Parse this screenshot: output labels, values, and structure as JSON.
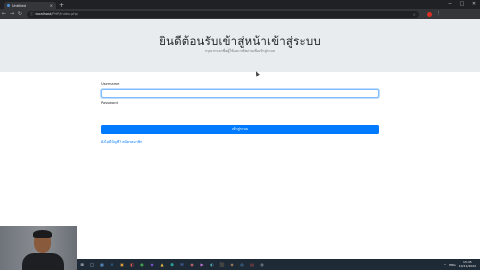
{
  "browser": {
    "tab_title": "Untitled",
    "tab_close": "×",
    "new_tab": "+",
    "window_controls": [
      "─",
      "□",
      "✕"
    ],
    "nav": [
      "←",
      "→",
      "↻"
    ],
    "url_host": "localhost",
    "url_path": "/PHP/index.php",
    "toolbar_icons": [
      "☆",
      "⋮"
    ]
  },
  "page": {
    "heading": "ยินดีต้อนรับเข้าสู่หน้าเข้าสู่ระบบ",
    "subheading": "กรุณากรอกชื่อผู้ใช้และรหัสผ่านเพื่อเข้าสู่ระบบ",
    "form": {
      "username_label": "Username",
      "username_value": "",
      "password_label": "Password",
      "submit_label": "เข้าสู่ระบบ",
      "register_link": "ยังไม่มีบัญชี? สมัครสมาชิก"
    }
  },
  "taskbar": {
    "icons": [
      "⊞",
      "◯",
      "▦",
      "e",
      "▣",
      "◧",
      "●",
      "◆",
      "▲",
      "⬢",
      "✉",
      "◉",
      "▶",
      "◐",
      "⬛",
      "◈",
      "◎",
      "▤",
      "◍"
    ],
    "icon_colors": [
      "#ffffff",
      "#9fb3c8",
      "#6aa9e9",
      "#2f7fd1",
      "#e8a33d",
      "#d9534f",
      "#3fa34d",
      "#7a4fd1",
      "#f0c040",
      "#2aa198",
      "#5b8def",
      "#e06c75",
      "#c678dd",
      "#56b6c2",
      "#98c379",
      "#d19a66",
      "#61afef",
      "#be5046",
      "#abb2bf"
    ],
    "tray": [
      "^",
      "ENG"
    ],
    "time": "10:45",
    "date": "10/11/2022"
  }
}
